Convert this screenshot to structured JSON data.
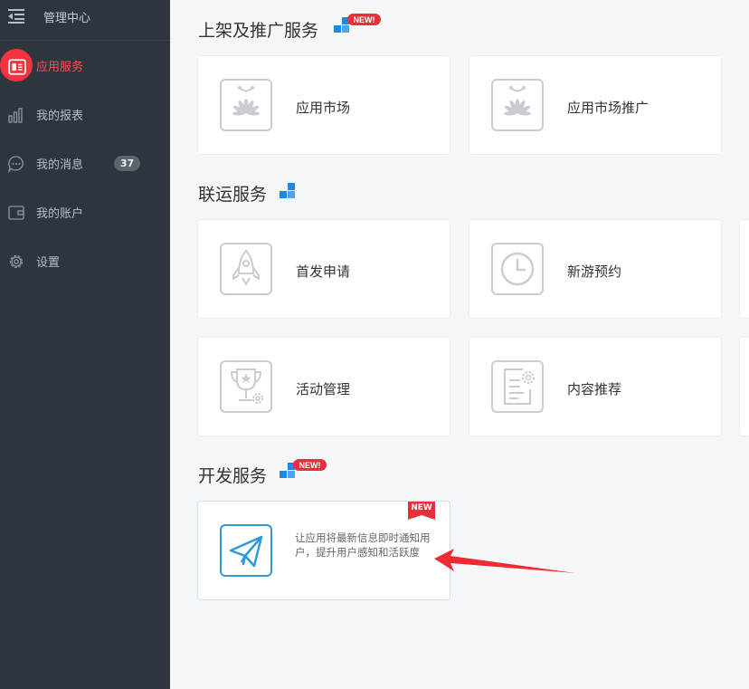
{
  "sidebar": {
    "title": "管理中心",
    "items": [
      {
        "label": "应用服务",
        "active": true,
        "icon": "app-service-icon"
      },
      {
        "label": "我的报表",
        "active": false,
        "icon": "bar-chart-icon"
      },
      {
        "label": "我的消息",
        "active": false,
        "icon": "message-bubble-icon",
        "badge": "37"
      },
      {
        "label": "我的账户",
        "active": false,
        "icon": "wallet-icon"
      },
      {
        "label": "设置",
        "active": false,
        "icon": "gear-icon"
      }
    ]
  },
  "sections": {
    "publish": {
      "title": "上架及推广服务",
      "new_badge": "NEW!",
      "cards": [
        {
          "name": "应用市场",
          "icon": "huawei-bag-icon"
        },
        {
          "name": "应用市场推广",
          "icon": "huawei-bag-icon"
        }
      ]
    },
    "joint": {
      "title": "联运服务",
      "cards": [
        {
          "name": "首发申请",
          "icon": "rocket-icon"
        },
        {
          "name": "新游预约",
          "icon": "clock-icon"
        },
        {
          "name": "活动管理",
          "icon": "trophy-gear-icon"
        },
        {
          "name": "内容推荐",
          "icon": "document-gear-icon"
        }
      ]
    },
    "dev": {
      "title": "开发服务",
      "new_badge": "NEW!",
      "cards": [
        {
          "description": "让应用将最新信息即时通知用户，提升用户感知和活跃度",
          "tag": "NEW",
          "icon": "paper-plane-icon"
        }
      ]
    }
  },
  "colors": {
    "sidebar_bg": "#2f353d",
    "accent_red": "#f3333d",
    "push_blue": "#2c9bd6",
    "block_icon_blue": "#1e88e5"
  }
}
